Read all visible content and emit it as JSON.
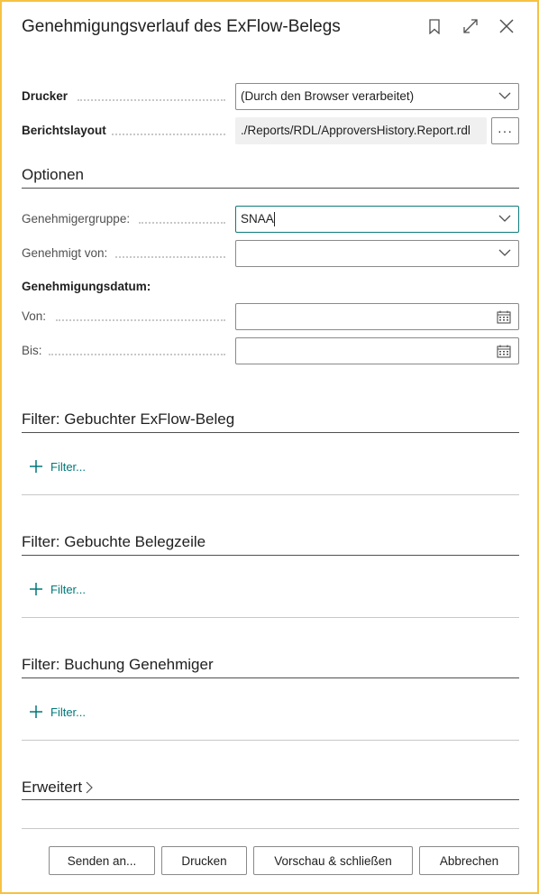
{
  "dialog": {
    "title": "Genehmigungsverlauf des ExFlow-Belegs"
  },
  "fields": {
    "drucker": {
      "label": "Drucker",
      "value": "(Durch den Browser verarbeitet)"
    },
    "berichtslayout": {
      "label": "Berichtslayout",
      "value": "./Reports/RDL/ApproversHistory.Report.rdl",
      "assist": "···"
    }
  },
  "optionen": {
    "title": "Optionen",
    "genehmigergruppe": {
      "label": "Genehmigergruppe:",
      "value": "SNAA"
    },
    "genehmigt_von": {
      "label": "Genehmigt von:",
      "value": ""
    },
    "datum_heading": "Genehmigungsdatum:",
    "von": {
      "label": "Von:",
      "value": ""
    },
    "bis": {
      "label": "Bis:",
      "value": ""
    }
  },
  "filters": [
    {
      "title": "Filter: Gebuchter ExFlow-Beleg",
      "link": "Filter..."
    },
    {
      "title": "Filter: Gebuchte Belegzeile",
      "link": "Filter..."
    },
    {
      "title": "Filter: Buchung Genehmiger",
      "link": "Filter..."
    }
  ],
  "erweitert": {
    "label": "Erweitert"
  },
  "buttons": {
    "senden": "Senden an...",
    "drucken": "Drucken",
    "vorschau": "Vorschau & schließen",
    "abbrechen": "Abbrechen"
  },
  "colors": {
    "accent": "#00787a",
    "focus_border": "#0f7b7b",
    "frame_border": "#f5c242"
  }
}
